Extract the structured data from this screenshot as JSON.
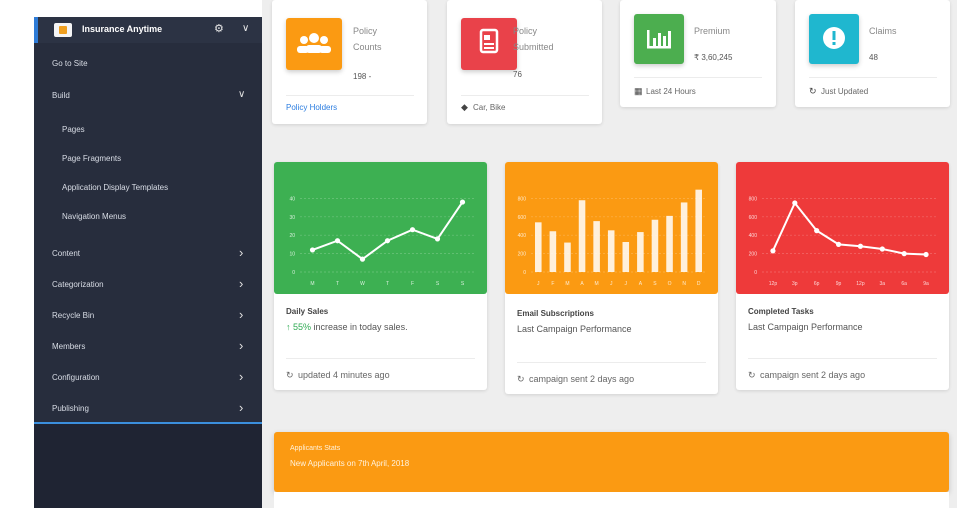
{
  "sidebar": {
    "site_name": "Insurance Anytime",
    "items": [
      {
        "label": "Go to Site"
      },
      {
        "label": "Build"
      },
      {
        "label": "Pages"
      },
      {
        "label": "Page Fragments"
      },
      {
        "label": "Application Display Templates"
      },
      {
        "label": "Navigation Menus"
      },
      {
        "label": "Content"
      },
      {
        "label": "Categorization"
      },
      {
        "label": "Recycle Bin"
      },
      {
        "label": "Members"
      },
      {
        "label": "Configuration"
      },
      {
        "label": "Publishing"
      }
    ]
  },
  "stats": [
    {
      "category_line1": "Policy",
      "category_line2": "Counts",
      "value": "198 -",
      "footer": "Policy Holders",
      "icon": "users-icon",
      "color": "#fb9a12"
    },
    {
      "category_line1": "Policy",
      "category_line2": "Submitted",
      "value": "76",
      "footer": "Car, Bike",
      "icon": "document-icon",
      "color": "#e9424a"
    },
    {
      "category_line1": "Premium",
      "category_line2": "",
      "value": "₹ 3,60,245",
      "footer": "Last 24 Hours",
      "icon": "bar-chart-icon",
      "color": "#4cae4f"
    },
    {
      "category_line1": "Claims",
      "category_line2": "",
      "value": "48",
      "footer": "Just Updated",
      "icon": "alert-icon",
      "color": "#1fb7cf"
    }
  ],
  "cards": [
    {
      "title": "Daily Sales",
      "subtitle_highlight": "↑ 55%",
      "subtitle_rest": " increase in today sales.",
      "footer": "updated 4 minutes ago"
    },
    {
      "title": "Email Subscriptions",
      "subtitle": "Last Campaign Performance",
      "footer": "campaign sent 2 days ago"
    },
    {
      "title": "Completed Tasks",
      "subtitle": "Last Campaign Performance",
      "footer": "campaign sent 2 days ago"
    }
  ],
  "chart_data": [
    {
      "type": "line",
      "categories": [
        "M",
        "T",
        "W",
        "T",
        "F",
        "S",
        "S"
      ],
      "values": [
        12,
        17,
        7,
        17,
        23,
        18,
        38
      ],
      "ylim": [
        0,
        50
      ],
      "y_ticks": [
        0,
        10,
        20,
        30,
        40
      ],
      "background": "#3db052",
      "grid": true
    },
    {
      "type": "bar",
      "categories": [
        "J",
        "F",
        "M",
        "A",
        "M",
        "J",
        "J",
        "A",
        "S",
        "O",
        "N",
        "D"
      ],
      "values": [
        540,
        443,
        320,
        780,
        553,
        453,
        326,
        434,
        568,
        610,
        756,
        895
      ],
      "ylim": [
        0,
        1000
      ],
      "y_ticks": [
        0,
        200,
        400,
        600,
        800
      ],
      "background": "#fb9a12",
      "grid": true
    },
    {
      "type": "line",
      "categories": [
        "12p",
        "3p",
        "6p",
        "9p",
        "12p",
        "3a",
        "6a",
        "9a"
      ],
      "values": [
        230,
        750,
        450,
        300,
        280,
        250,
        200,
        190
      ],
      "ylim": [
        0,
        1000
      ],
      "y_ticks": [
        0,
        200,
        400,
        600,
        800
      ],
      "background": "#ee3a3a",
      "grid": true
    }
  ],
  "applicants": {
    "title": "Applicants Stats",
    "subtitle": "New Applicants on 7th April, 2018"
  }
}
